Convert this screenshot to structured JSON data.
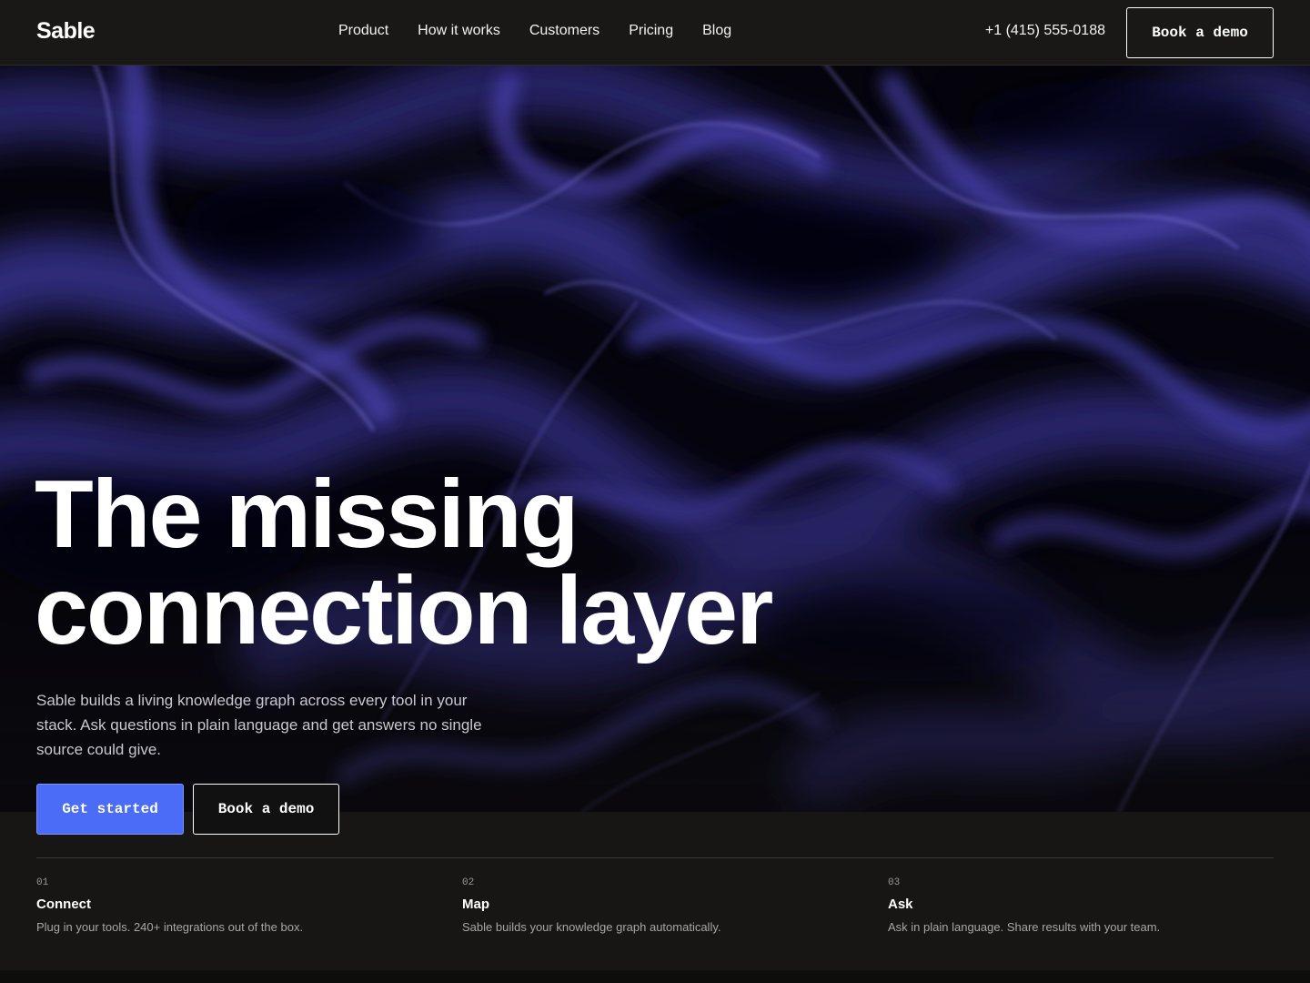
{
  "brand": {
    "name": "Sable"
  },
  "nav": {
    "links": [
      "Product",
      "How it works",
      "Customers",
      "Pricing",
      "Blog"
    ],
    "phone": "+1 (415) 555-0188",
    "demo_label": "Book a demo"
  },
  "hero": {
    "headline_line1": "The missing",
    "headline_line2": "connection layer",
    "subtext": "Sable builds a living knowledge graph across every tool in your stack. Ask questions in plain language and get answers no single source could give.",
    "primary_cta": "Get started",
    "secondary_cta": "Book a demo",
    "background_icon": "abstract-wave-image"
  },
  "steps": [
    {
      "num": "01",
      "title": "Connect",
      "desc": "Plug in your tools. 240+ integrations out of the box."
    },
    {
      "num": "02",
      "title": "Map",
      "desc": "Sable builds your knowledge graph automatically."
    },
    {
      "num": "03",
      "title": "Ask",
      "desc": "Ask in plain language. Share results with your team."
    }
  ],
  "colors": {
    "background": "#171614",
    "accent": "#4a6cf7",
    "wave": "#3b358f"
  }
}
